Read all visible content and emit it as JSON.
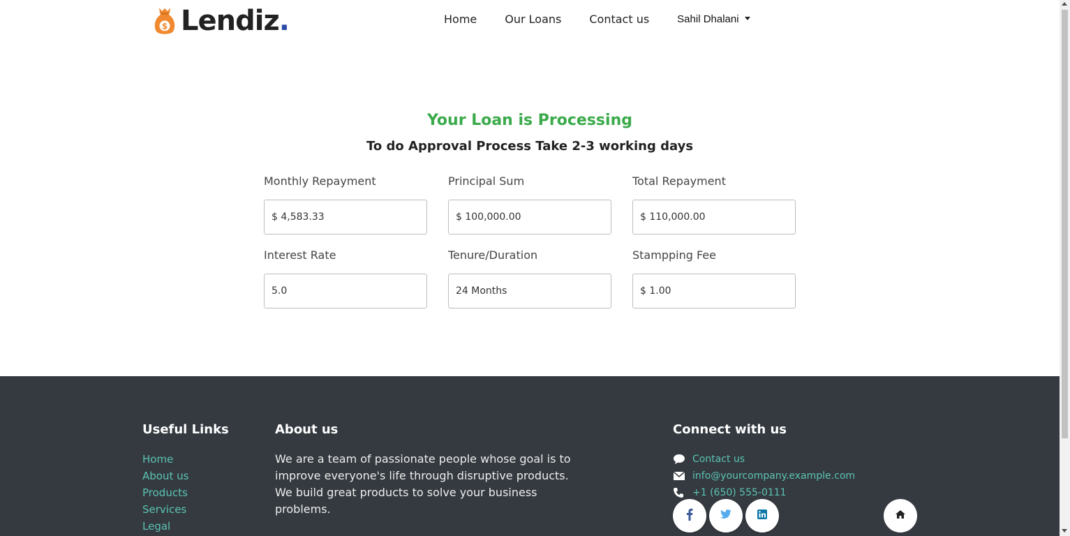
{
  "brand": {
    "name": "Lendiz",
    "dot": ".",
    "colors": {
      "bag": "#f0892f",
      "dot": "#2a4aa8",
      "accent_green": "#3aaa4a",
      "link": "#5cc3b3",
      "footer_bg": "#343a40"
    }
  },
  "nav": {
    "items": [
      "Home",
      "Our Loans",
      "Contact us"
    ],
    "user": "Sahil Dhalani"
  },
  "main": {
    "title": "Your Loan is Processing",
    "subtitle": "To do Approval Process Take 2-3 working days",
    "fields": [
      {
        "label": "Monthly Repayment",
        "value": "$ 4,583.33"
      },
      {
        "label": "Principal Sum",
        "value": "$ 100,000.00"
      },
      {
        "label": "Total Repayment",
        "value": "$ 110,000.00"
      },
      {
        "label": "Interest Rate",
        "value": "5.0"
      },
      {
        "label": "Tenure/Duration",
        "value": "24 Months"
      },
      {
        "label": "Stampping Fee",
        "value": "$ 1.00"
      }
    ]
  },
  "footer": {
    "useful_links": {
      "heading": "Useful Links",
      "items": [
        "Home",
        "About us",
        "Products",
        "Services",
        "Legal"
      ]
    },
    "about": {
      "heading": "About us",
      "text": "We are a team of passionate people whose goal is to improve everyone's life through disruptive products. We build great products to solve your business problems."
    },
    "connect": {
      "heading": "Connect with us",
      "items": [
        {
          "icon": "chat-icon",
          "text": "Contact us"
        },
        {
          "icon": "envelope-icon",
          "text": "info@yourcompany.example.com"
        },
        {
          "icon": "phone-icon",
          "text": "+1 (650) 555-0111"
        }
      ],
      "socials": [
        "facebook-icon",
        "twitter-icon",
        "linkedin-icon"
      ]
    }
  }
}
